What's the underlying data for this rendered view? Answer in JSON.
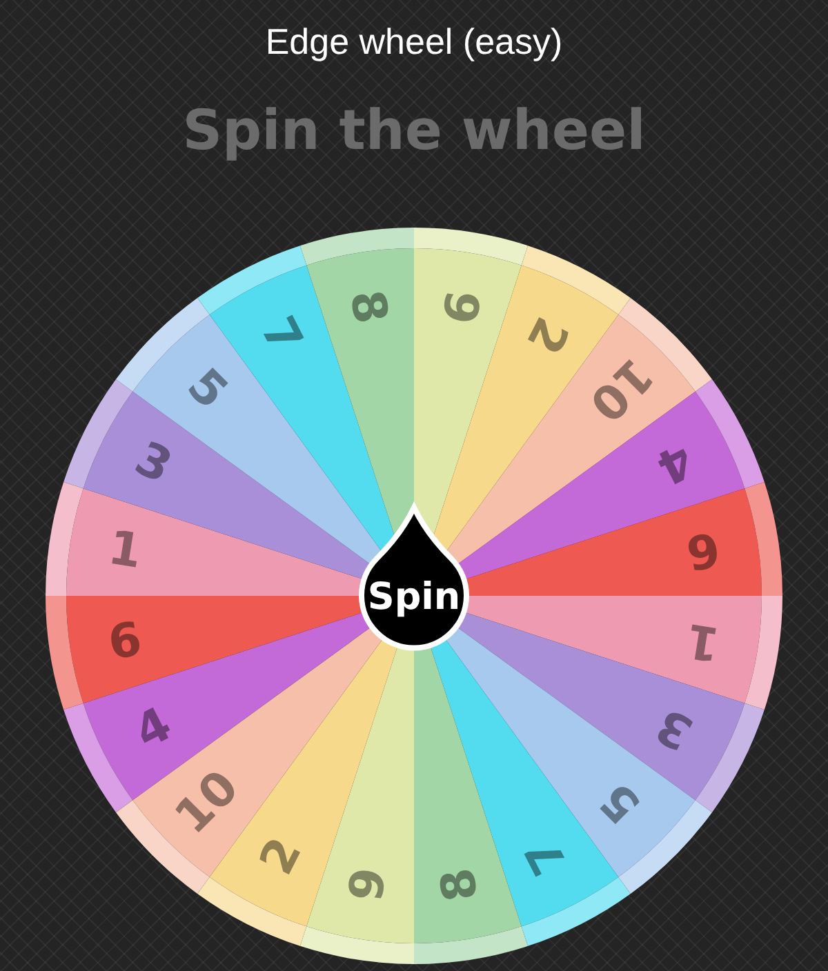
{
  "title": "Edge wheel (easy)",
  "heading": "Spin the wheel",
  "wheel": {
    "segments": [
      {
        "label": "9",
        "color": "#dfe8a9"
      },
      {
        "label": "2",
        "color": "#f6d98b"
      },
      {
        "label": "10",
        "color": "#f5bfa9"
      },
      {
        "label": "4",
        "color": "#c46ad8"
      },
      {
        "label": "6",
        "color": "#ee5a51"
      },
      {
        "label": "1",
        "color": "#ee9bb1"
      },
      {
        "label": "3",
        "color": "#a98fd7"
      },
      {
        "label": "5",
        "color": "#a8c9ee"
      },
      {
        "label": "7",
        "color": "#53dcef"
      },
      {
        "label": "8",
        "color": "#a3d6a7"
      },
      {
        "label": "9",
        "color": "#dfe8a9"
      },
      {
        "label": "2",
        "color": "#f6d98b"
      },
      {
        "label": "10",
        "color": "#f5bfa9"
      },
      {
        "label": "4",
        "color": "#c46ad8"
      },
      {
        "label": "6",
        "color": "#ee5a51"
      },
      {
        "label": "1",
        "color": "#ee9bb1"
      },
      {
        "label": "3",
        "color": "#a98fd7"
      },
      {
        "label": "5",
        "color": "#a8c9ee"
      },
      {
        "label": "7",
        "color": "#53dcef"
      },
      {
        "label": "8",
        "color": "#a3d6a7"
      }
    ],
    "button": "Spin"
  }
}
